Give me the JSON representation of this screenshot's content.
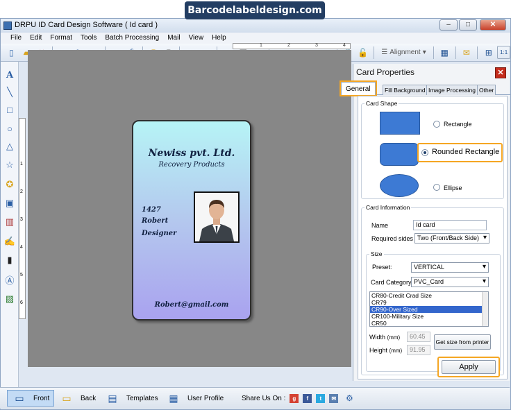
{
  "banner": {
    "text": "Barcodelabeldesign.com"
  },
  "window": {
    "title": "DRPU ID Card Design Software ( Id card )",
    "controls": [
      "–",
      "□",
      "✕"
    ]
  },
  "menu": [
    "File",
    "Edit",
    "Format",
    "Tools",
    "Batch Processing",
    "Mail",
    "View",
    "Help"
  ],
  "toolbar": {
    "alignment_label": "Alignment",
    "zoom_label": "1:1"
  },
  "card": {
    "company": "Newiss pvt. Ltd.",
    "subtitle": "Recovery Products",
    "id": "1427",
    "name": "Robert",
    "role": "Designer",
    "email": "Robert@gmail.com"
  },
  "panel": {
    "title": "Card Properties",
    "close": "✕",
    "tabs": [
      "General",
      "Fill Background",
      "Image Processing",
      "Other"
    ],
    "card_shape": {
      "legend": "Card Shape",
      "options": [
        "Rectangle",
        "Rounded Rectangle",
        "Ellipse"
      ],
      "selected": "Rounded Rectangle"
    },
    "card_info": {
      "legend": "Card Information",
      "name_label": "Name",
      "name_value": "Id card",
      "sides_label": "Required sides",
      "sides_value": "Two (Front/Back Side)"
    },
    "size": {
      "legend": "Size",
      "preset_label": "Preset:",
      "preset_value": "VERTICAL",
      "category_label": "Card Category",
      "category_value": "PVC_Card",
      "list": [
        "CR80-Credit Crad Size",
        "CR79",
        "CR90-Over Sized",
        "CR100-Military Size",
        "CR50"
      ],
      "selected_index": 2,
      "width_label": "Width",
      "height_label": "Height",
      "unit": "(mm)",
      "width_value": "60.45",
      "height_value": "91.95",
      "get_size_button": "Get size from printer"
    },
    "apply_button": "Apply"
  },
  "statusbar": {
    "front": "Front",
    "back": "Back",
    "templates": "Templates",
    "user_profile": "User Profile",
    "share_label": "Share Us On :"
  },
  "ruler": {
    "h_marks": [
      "1",
      "2",
      "3",
      "4"
    ],
    "v_marks": [
      "1",
      "2",
      "3",
      "4",
      "5",
      "6"
    ]
  },
  "colors": {
    "accent_highlight": "#f5a623",
    "canvas_bg": "#878787",
    "shape_blue": "#3d7ad4"
  }
}
